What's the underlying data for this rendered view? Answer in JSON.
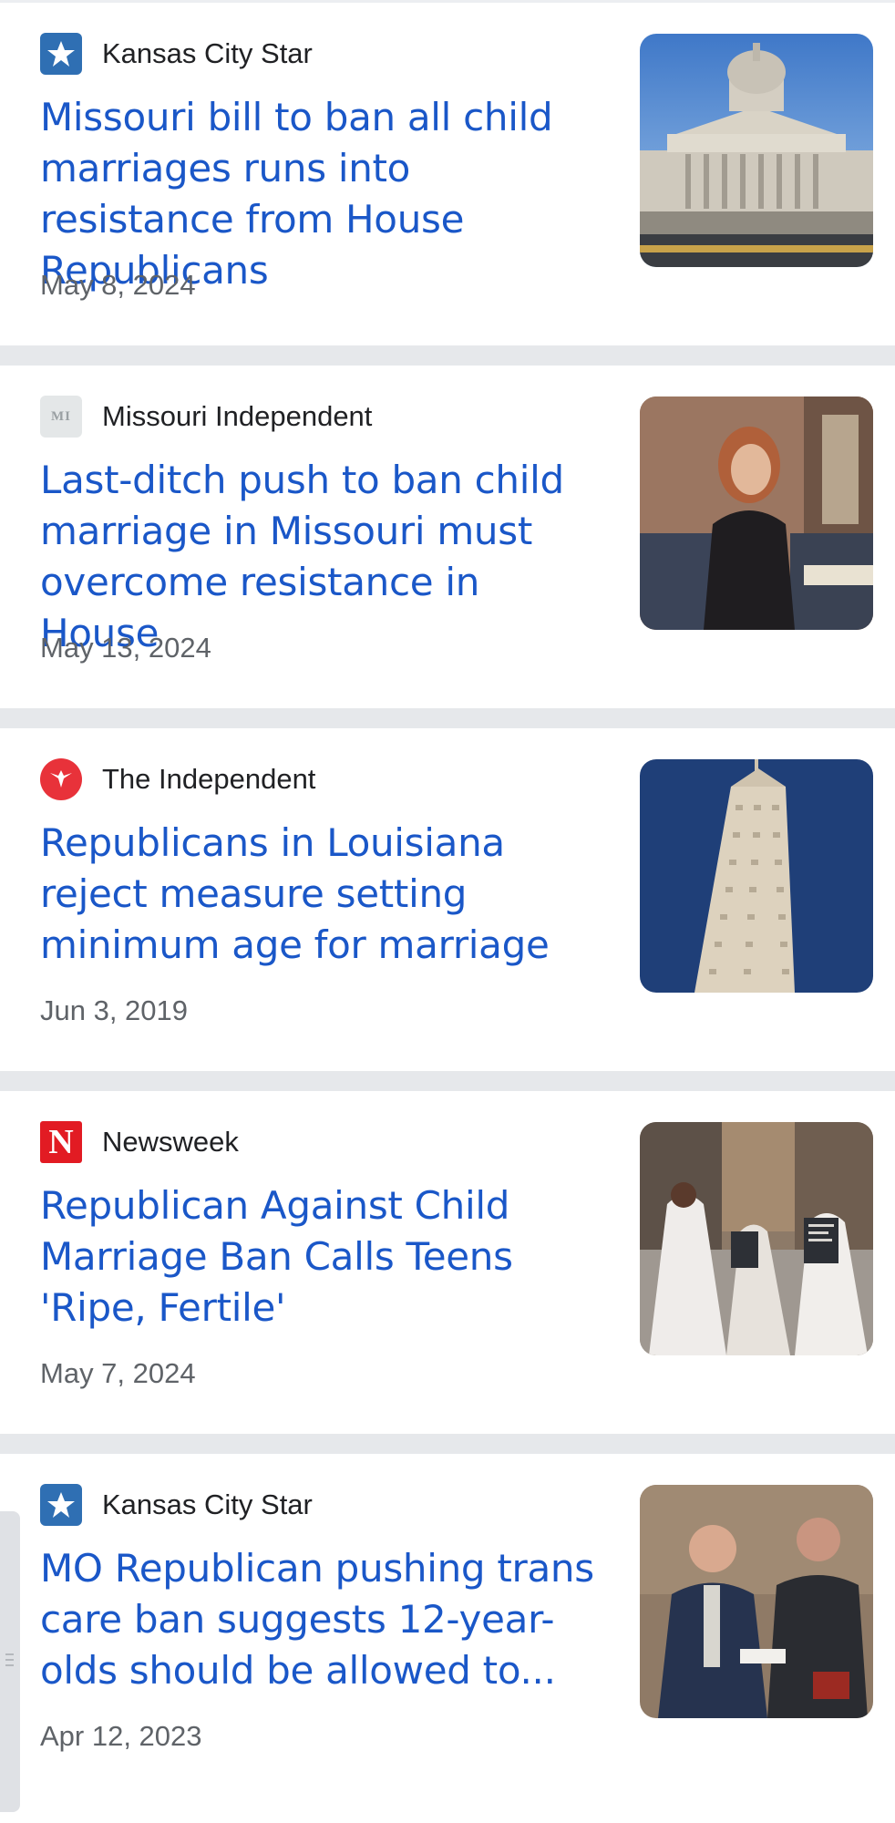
{
  "colors": {
    "headline": "#1a57c8",
    "source_text": "#202124",
    "date_text": "#5f6368",
    "separator": "#e6e8eb"
  },
  "articles": [
    {
      "source": "Kansas City Star",
      "favicon": "star-icon",
      "headline": "Missouri bill to ban all child marriages runs into resistance from House Republicans",
      "date": "May 8, 2024",
      "thumbnail": "capitol-building-image"
    },
    {
      "source": "Missouri Independent",
      "favicon": "mi-logo-icon",
      "favicon_text": "MI",
      "headline": "Last-ditch push to ban child marriage in Missouri must overcome resistance in House",
      "date": "May 13, 2024",
      "thumbnail": "legislator-portrait-image"
    },
    {
      "source": "The Independent",
      "favicon": "eagle-icon",
      "headline": "Republicans in Louisiana reject measure setting minimum age for marriage",
      "date": "Jun 3, 2019",
      "thumbnail": "capitol-tower-image"
    },
    {
      "source": "Newsweek",
      "favicon": "newsweek-n-icon",
      "favicon_text": "N",
      "headline": "Republican Against Child Marriage Ban Calls Teens 'Ripe, Fertile'",
      "date": "May 7, 2024",
      "thumbnail": "protest-brides-image"
    },
    {
      "source": "Kansas City Star",
      "favicon": "star-icon",
      "headline": "MO Republican pushing trans care ban suggests 12-year-olds should be allowed to...",
      "date": "Apr 12, 2023",
      "thumbnail": "two-men-image"
    }
  ]
}
